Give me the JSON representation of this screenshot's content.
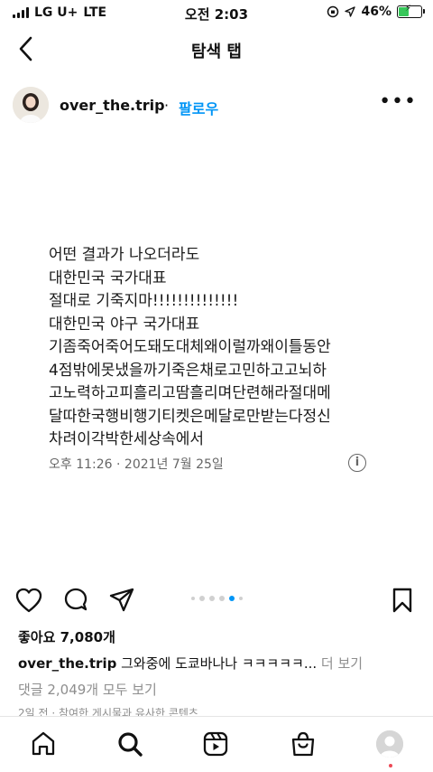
{
  "status_bar": {
    "carrier": "LG U+",
    "network": "LTE",
    "time": "오전 2:03",
    "battery": "46%",
    "battery_level": 0.46
  },
  "nav": {
    "title": "탐색 탭"
  },
  "post": {
    "username": "over_the.trip",
    "separator": "·",
    "follow_label": "팔로우",
    "more_label": "•••",
    "tweet_lines": [
      "어떤 결과가 나오더라도",
      "대한민국 국가대표",
      "절대로 기죽지마!!!!!!!!!!!!!!",
      "대한민국 야구 국가대표",
      "기좀죽어죽어도돼도대체왜이럴까왜이틀동안",
      "4점밖에못냈을까기죽은채로고민하고고뇌하",
      "고노력하고피흘리고땀흘리며단련해라절대메",
      "달따한국행비행기티켓은메달로만받는다정신",
      "차려이각박한세상속에서"
    ],
    "tweet_timestamp": "오후 11:26 · 2021년 7월 25일",
    "info_icon_label": "i",
    "carousel": {
      "count": 6,
      "active_index": 4
    },
    "likes": "좋아요 7,080개",
    "caption_user": "over_the.trip",
    "caption_text": " 그와중에 도쿄바나나 ㅋㅋㅋㅋㅋ...",
    "caption_more": " 더 보기",
    "comments_link": "댓글 2,049개 모두 보기",
    "time_ago": "2일 전 · 참여한 게시물과 유사한 콘텐츠"
  },
  "tabbar": {
    "items": [
      "home-icon",
      "search-icon",
      "reels-icon",
      "shop-icon",
      "profile-avatar"
    ]
  },
  "colors": {
    "accent": "#0095f6",
    "battery": "#36c759",
    "notification": "#ed4956"
  }
}
